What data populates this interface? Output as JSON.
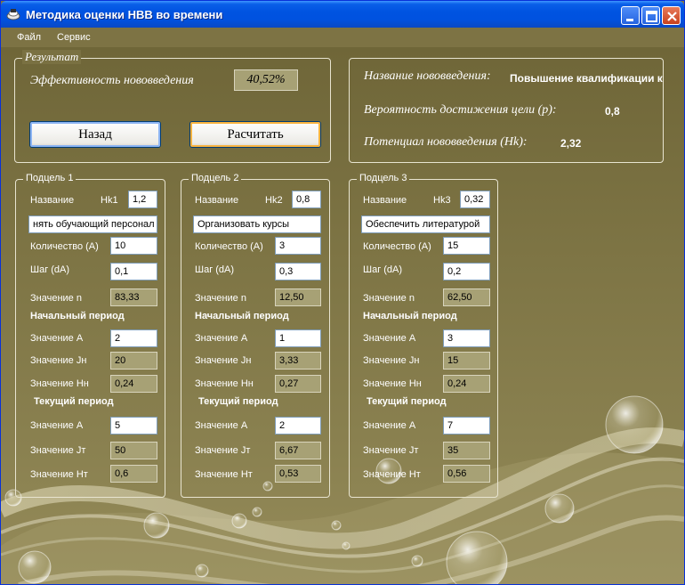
{
  "window": {
    "title": "Методика оценки НВВ во времени"
  },
  "menu": [
    "Файл",
    "Сервис"
  ],
  "result": {
    "legend": "Результат",
    "efficiency_label": "Эффективность нововведения",
    "efficiency_value": "40,52%",
    "back_button": "Назад",
    "calc_button": "Расчитать"
  },
  "info": {
    "name_label": "Название нововведения:",
    "name_value": "Повышение квалификации к",
    "prob_label": "Вероятность достижения цели (p):",
    "prob_value": "0,8",
    "potential_label": "Потенциал нововведения (Hk):",
    "potential_value": "2,32"
  },
  "labels": {
    "name": "Название",
    "quantity": "Количество (A)",
    "step": "Шаг (dA)",
    "value_n": "Значение n",
    "initial_period": "Начальный период",
    "value_a": "Значение A",
    "value_jn": "Значение Jн",
    "value_hn": "Значение Hн",
    "current_period": "Текущий период",
    "value_jt": "Значение Jт",
    "value_ht": "Значение Hт"
  },
  "subgoals": [
    {
      "legend": "Подцель 1",
      "hk_label": "Hk1",
      "hk": "1,2",
      "name": "нять обучающий персонал",
      "quantity": "10",
      "step": "0,1",
      "n": "83,33",
      "a_init": "2",
      "jn": "20",
      "hn": "0,24",
      "a_cur": "5",
      "jt": "50",
      "ht": "0,6"
    },
    {
      "legend": "Подцель 2",
      "hk_label": "Hk2",
      "hk": "0,8",
      "name": "Организовать курсы",
      "quantity": "3",
      "step": "0,3",
      "n": "12,50",
      "a_init": "1",
      "jn": "3,33",
      "hn": "0,27",
      "a_cur": "2",
      "jt": "6,67",
      "ht": "0,53"
    },
    {
      "legend": "Подцель 3",
      "hk_label": "Hk3",
      "hk": "0,32",
      "name": "Обеспечить литературой",
      "quantity": "15",
      "step": "0,2",
      "n": "62,50",
      "a_init": "3",
      "jn": "15",
      "hn": "0,24",
      "a_cur": "7",
      "jt": "35",
      "ht": "0,56"
    }
  ]
}
